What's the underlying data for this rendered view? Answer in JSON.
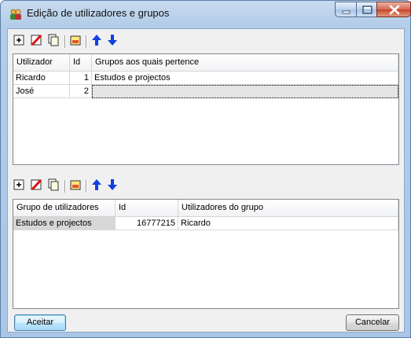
{
  "window": {
    "title": "Edição de utilizadores e grupos",
    "accent": "#a9c6e6"
  },
  "titlebar_controls": [
    "minimize-icon",
    "maximize-icon",
    "close-icon"
  ],
  "toolbar_icons": [
    "add-icon",
    "delete-icon",
    "copy-icon",
    "edit-icon",
    "move-up-icon",
    "move-down-icon"
  ],
  "users_grid": {
    "columns": [
      "Utilizador",
      "Id",
      "Grupos aos quais pertence"
    ],
    "rows": [
      {
        "user": "Ricardo",
        "id": "1",
        "groups": "Estudos e projectos"
      },
      {
        "user": "José",
        "id": "2",
        "groups": ""
      }
    ]
  },
  "groups_grid": {
    "columns": [
      "Grupo de utilizadores",
      "Id",
      "Utilizadores do grupo"
    ],
    "rows": [
      {
        "group": "Estudos e projectos",
        "id": "16777215",
        "users": "Ricardo"
      }
    ]
  },
  "buttons": {
    "accept": "Aceitar",
    "cancel": "Cancelar"
  }
}
